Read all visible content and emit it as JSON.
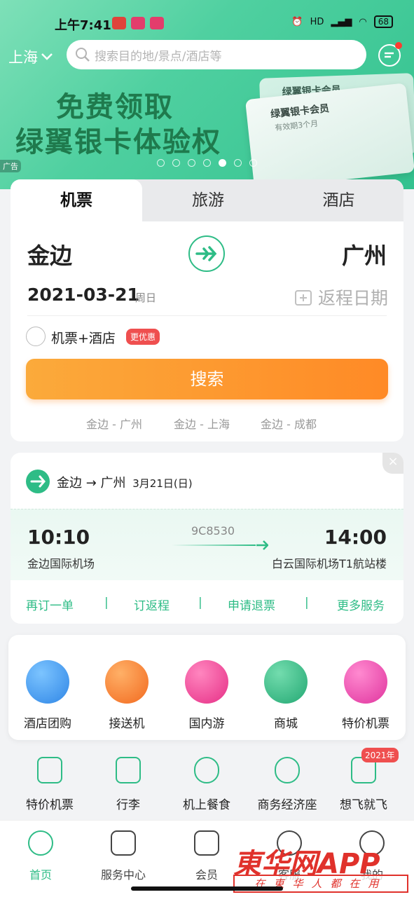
{
  "status_bar": {
    "time": "上午7:41",
    "battery": "68",
    "hd_label": "HD"
  },
  "header": {
    "city": "上海",
    "search_placeholder": "搜索目的地/景点/酒店等"
  },
  "banner": {
    "headline_line1": "免费领取",
    "headline_line2": "绿翼银卡体验权",
    "card_back_title": "绿翼银卡会员",
    "card_title": "绿翼银卡会员",
    "card_sub": "有效期3个月",
    "ad_label": "广告",
    "dots_total": 7,
    "dots_active_index": 4
  },
  "booking": {
    "tabs": [
      {
        "label": "机票",
        "active": true
      },
      {
        "label": "旅游",
        "active": false
      },
      {
        "label": "酒店",
        "active": false
      }
    ],
    "from_city": "金边",
    "to_city": "广州",
    "date": "2021-03-21",
    "weekday": "周日",
    "return_label": "返程日期",
    "combo_label": "机票+酒店",
    "combo_badge": "更优惠",
    "search_label": "搜索",
    "history": [
      "金边 - 广州",
      "金边 - 上海",
      "金边 - 成都"
    ]
  },
  "trip": {
    "route": "金边 → 广州",
    "date": "3月21日(日)",
    "dep_time": "10:10",
    "arr_time": "14:00",
    "flight_no": "9C8530",
    "dep_airport": "金边国际机场",
    "arr_airport": "白云国际机场T1航站楼",
    "close": "×",
    "actions": [
      "再订一单",
      "订返程",
      "申请退票",
      "更多服务"
    ],
    "separator": "|"
  },
  "services": [
    {
      "label": "酒店团购",
      "icon": "hotel-icon",
      "color": "#3f9af0"
    },
    {
      "label": "接送机",
      "icon": "car-icon",
      "color": "#f7772b"
    },
    {
      "label": "国内游",
      "icon": "temple-icon",
      "color": "#ee3f8f"
    },
    {
      "label": "商城",
      "icon": "mall-icon",
      "color": "#2ebc86"
    },
    {
      "label": "特价机票",
      "icon": "ticket-icon",
      "color": "#ec3fa6"
    }
  ],
  "mini_services": [
    {
      "label": "特价机票",
      "icon": "discount-tag-icon"
    },
    {
      "label": "行李",
      "icon": "luggage-icon"
    },
    {
      "label": "机上餐食",
      "icon": "meal-icon"
    },
    {
      "label": "商务经济座",
      "icon": "business-seat-icon"
    },
    {
      "label": "想飞就飞",
      "icon": "fly-pass-icon",
      "badge": "2021年"
    }
  ],
  "nav": [
    {
      "label": "首页",
      "icon": "home-icon",
      "active": true
    },
    {
      "label": "服务中心",
      "icon": "service-center-icon",
      "active": false
    },
    {
      "label": "会员",
      "icon": "member-icon",
      "active": false
    },
    {
      "label": "客服",
      "icon": "customer-service-icon",
      "active": false
    },
    {
      "label": "我的",
      "icon": "profile-icon",
      "active": false
    }
  ],
  "watermark": {
    "title": "東华网APP",
    "slogan": "在東华人都在用"
  },
  "colors": {
    "brand": "#2ebc86",
    "orange": "#ff8a26",
    "red": "#ef4f4f"
  }
}
